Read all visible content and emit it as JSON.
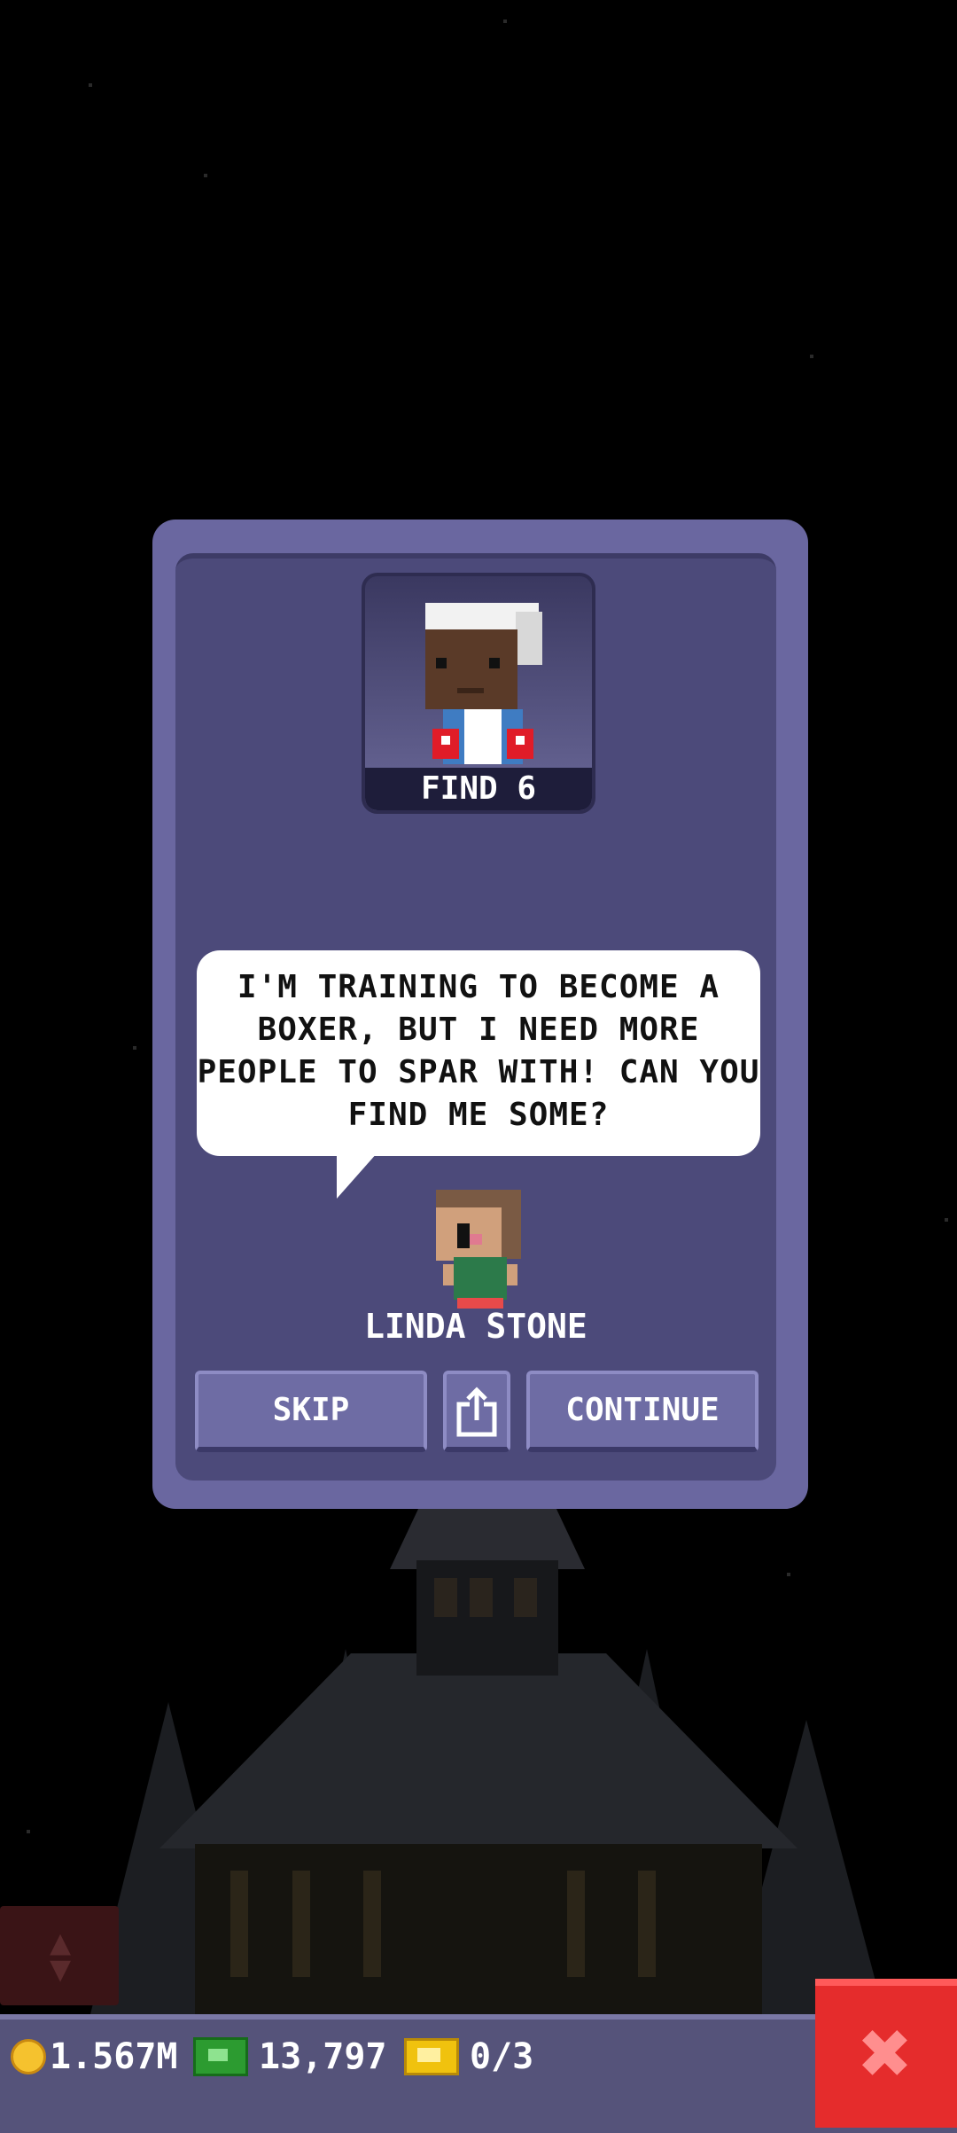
{
  "quest": {
    "goal_label": "FIND 6",
    "dialogue": "I'M TRAINING TO BECOME A BOXER, BUT I NEED MORE PEOPLE TO SPAR WITH! CAN YOU FIND ME SOME?",
    "npc_name": "LINDA STONE"
  },
  "buttons": {
    "skip": "SKIP",
    "share_icon": "share-icon",
    "continue": "CONTINUE"
  },
  "status_bar": {
    "coins": "1.567M",
    "bux": "13,797",
    "tickets": "0/3"
  },
  "colors": {
    "dialog_bg": "#4c4a7a",
    "button": "#6e6ca4",
    "close_button": "#e52c2c"
  }
}
